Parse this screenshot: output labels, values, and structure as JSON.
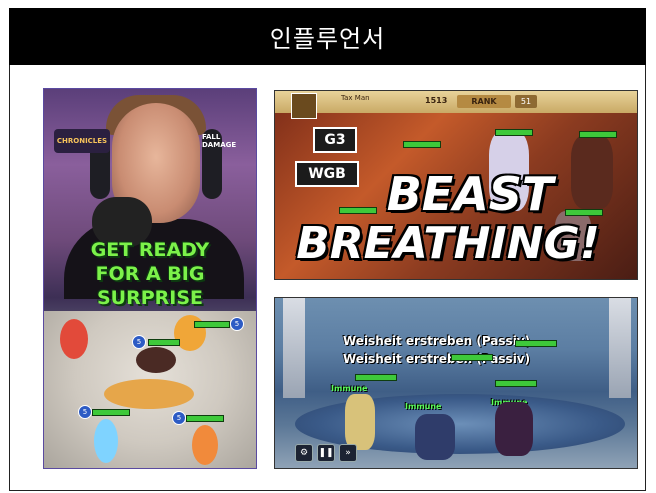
{
  "header": {
    "title": "인플루언서"
  },
  "thumbnails": {
    "short": {
      "logo_left": "CHRONICLES",
      "logo_right": "FALL DAMAGE",
      "headline_lines": [
        "GET READY",
        "FOR A BIG",
        "SURPRISE"
      ],
      "badges": [
        "5",
        "5",
        "5",
        "5"
      ]
    },
    "beast": {
      "player_name": "Tax Man",
      "currency": "1513",
      "rank_label": "RANK",
      "rank_value": "51",
      "tag_1": "G3",
      "tag_2": "WGB",
      "headline_1": "BEAST",
      "headline_2": "BREATHING!"
    },
    "battle": {
      "skill_text_1": "Weisheit erstreben (Passiv)",
      "skill_text_2": "Weisheit erstreben (Passiv)",
      "unit_label_1": "Immune",
      "unit_label_2": "Immune",
      "unit_label_3": "Immune",
      "controls": [
        "⚙",
        "❚❚",
        "»"
      ]
    }
  },
  "colors": {
    "header_bg": "#000000",
    "headline_green": "#7cf24a"
  }
}
